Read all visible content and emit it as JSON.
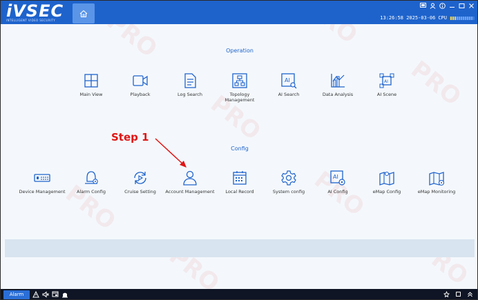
{
  "brand": {
    "logo": "iVSEC",
    "tagline": "INTELLIGENT VIDEO SECURITY"
  },
  "status": {
    "clock": "13:26:58 2025-03-06",
    "cpu_label": "CPU"
  },
  "sections": {
    "operation": {
      "title": "Operation",
      "items": [
        {
          "label": "Main View",
          "icon": "grid-window-icon"
        },
        {
          "label": "Playback",
          "icon": "video-camera-icon"
        },
        {
          "label": "Log Search",
          "icon": "document-icon"
        },
        {
          "label": "Topology Management",
          "icon": "topology-icon"
        },
        {
          "label": "AI Search",
          "icon": "ai-search-icon"
        },
        {
          "label": "Data Analysis",
          "icon": "chart-icon"
        },
        {
          "label": "AI Scene",
          "icon": "ai-scene-icon"
        }
      ]
    },
    "config": {
      "title": "Config",
      "items": [
        {
          "label": "Device Management",
          "icon": "device-icon"
        },
        {
          "label": "Alarm Config",
          "icon": "alarm-bell-icon"
        },
        {
          "label": "Cruise Setting",
          "icon": "cruise-icon"
        },
        {
          "label": "Account Management",
          "icon": "user-icon"
        },
        {
          "label": "Local Record",
          "icon": "calendar-icon"
        },
        {
          "label": "System config",
          "icon": "gear-icon"
        },
        {
          "label": "AI Config",
          "icon": "ai-config-icon"
        },
        {
          "label": "eMap Config",
          "icon": "map-pin-icon"
        },
        {
          "label": "eMap Monitoring",
          "icon": "map-monitor-icon"
        }
      ]
    }
  },
  "annotation": {
    "step": "Step 1"
  },
  "bottombar": {
    "alarm_label": "Alarm"
  },
  "colors": {
    "brand_blue": "#1e63cc",
    "annotation_red": "#e01515"
  }
}
